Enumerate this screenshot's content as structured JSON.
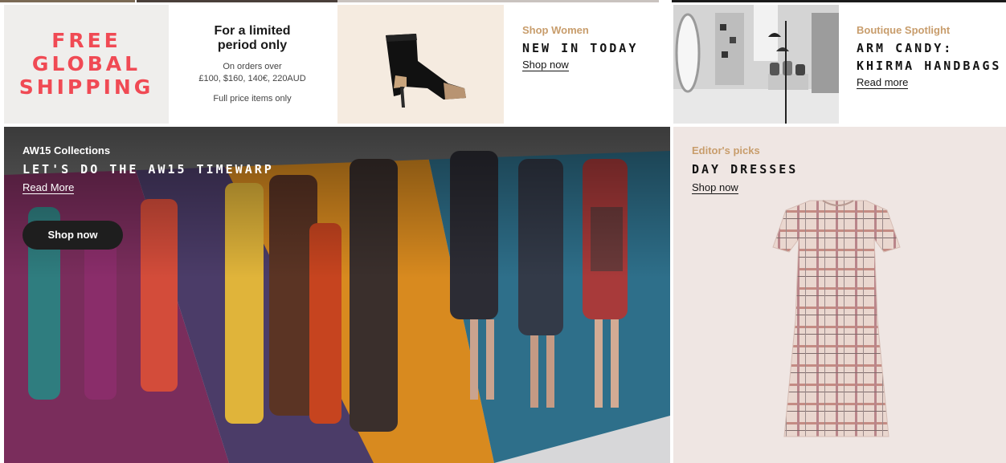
{
  "colors": {
    "accent_red": "#f04a54",
    "eyebrow_tan": "#c89d6c",
    "free_bg": "#efeeec",
    "shoe_bg": "#f5ebe0",
    "editor_bg": "#efe6e3",
    "button_dark": "#1e1e1e"
  },
  "promo": {
    "free_shipping_lines": [
      "FREE",
      "GLOBAL",
      "SHIPPING"
    ],
    "limited_heading_lines": [
      "For a limited",
      "period only"
    ],
    "limited_sub_lines": [
      "On orders over",
      "£100, $160, 140€, 220AUD"
    ],
    "limited_footnote": "Full price items only"
  },
  "new_in": {
    "image_alt": "black-ankle-boot-image",
    "eyebrow": "Shop Women",
    "headline": "NEW IN TODAY",
    "link": "Shop now"
  },
  "boutique": {
    "image_alt": "boutique-interior-photo",
    "eyebrow": "Boutique Spotlight",
    "headline_lines": [
      "ARM CANDY:",
      "KHIRMA HANDBAGS"
    ],
    "link": "Read more"
  },
  "hero": {
    "image_alt": "aw15-runway-collage",
    "eyebrow": "AW15 Collections",
    "headline": "LET'S DO THE AW15 TIMEWARP",
    "link": "Read More",
    "button": "Shop now"
  },
  "editor": {
    "image_alt": "plaid-day-dress",
    "eyebrow": "Editor's picks",
    "headline": "DAY DRESSES",
    "link": "Shop now"
  }
}
